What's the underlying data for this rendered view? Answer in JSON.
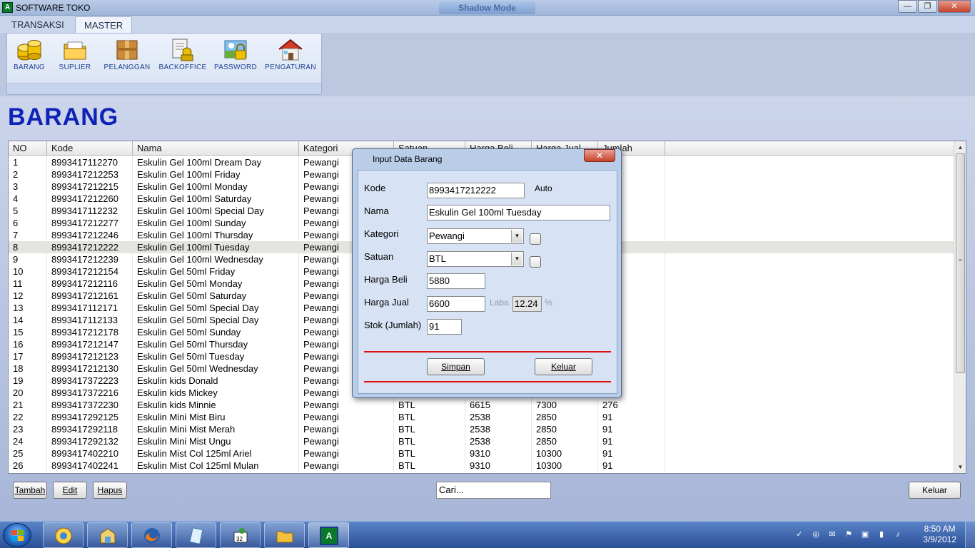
{
  "window": {
    "title": "SOFTWARE TOKO",
    "app_icon_letter": "A",
    "banner": "Shadow Mode",
    "min_glyph": "—",
    "max_glyph": "❐",
    "close_glyph": "✕"
  },
  "ribbon": {
    "tabs": [
      {
        "label": "TRANSAKSI"
      },
      {
        "label": "MASTER"
      }
    ],
    "active_tab": "MASTER",
    "items": [
      {
        "label": "BARANG",
        "icon": "coins-icon"
      },
      {
        "label": "SUPLIER",
        "icon": "folder-icon"
      },
      {
        "label": "PELANGGAN",
        "icon": "box-icon"
      },
      {
        "label": "BACKOFFICE",
        "icon": "office-icon"
      },
      {
        "label": "PASSWORD",
        "icon": "lock-icon"
      },
      {
        "label": "PENGATURAN",
        "icon": "house-icon"
      }
    ]
  },
  "page": {
    "title": "BARANG"
  },
  "table": {
    "headers": [
      "NO",
      "Kode",
      "Nama",
      "Kategori",
      "Satuan",
      "Harga Beli",
      "Harga Jual",
      "Jumlah"
    ],
    "selected_row": 8,
    "rows": [
      [
        "1",
        "8993417112270",
        "Eskulin Gel 100ml Dream Day",
        "Pewangi",
        "",
        "",
        "",
        ""
      ],
      [
        "2",
        "8993417212253",
        "Eskulin Gel 100ml Friday",
        "Pewangi",
        "",
        "",
        "",
        ""
      ],
      [
        "3",
        "8993417212215",
        "Eskulin Gel 100ml Monday",
        "Pewangi",
        "",
        "",
        "",
        ""
      ],
      [
        "4",
        "8993417212260",
        "Eskulin Gel 100ml Saturday",
        "Pewangi",
        "",
        "",
        "",
        ""
      ],
      [
        "5",
        "8993417112232",
        "Eskulin Gel 100ml Special Day",
        "Pewangi",
        "",
        "",
        "",
        ""
      ],
      [
        "6",
        "8993417212277",
        "Eskulin Gel 100ml Sunday",
        "Pewangi",
        "",
        "",
        "",
        ""
      ],
      [
        "7",
        "8993417212246",
        "Eskulin Gel 100ml Thursday",
        "Pewangi",
        "",
        "",
        "",
        ""
      ],
      [
        "8",
        "8993417212222",
        "Eskulin Gel 100ml Tuesday",
        "Pewangi",
        "",
        "",
        "",
        ""
      ],
      [
        "9",
        "8993417212239",
        "Eskulin Gel 100ml Wednesday",
        "Pewangi",
        "",
        "",
        "",
        ""
      ],
      [
        "10",
        "8993417212154",
        "Eskulin Gel 50ml Friday",
        "Pewangi",
        "",
        "",
        "",
        ""
      ],
      [
        "11",
        "8993417212116",
        "Eskulin Gel 50ml Monday",
        "Pewangi",
        "",
        "",
        "",
        ""
      ],
      [
        "12",
        "8993417212161",
        "Eskulin Gel 50ml Saturday",
        "Pewangi",
        "",
        "",
        "",
        ""
      ],
      [
        "13",
        "8993417112171",
        "Eskulin Gel 50ml Special Day",
        "Pewangi",
        "",
        "",
        "",
        ""
      ],
      [
        "14",
        "8993417112133",
        "Eskulin Gel 50ml Special Day",
        "Pewangi",
        "",
        "",
        "",
        ""
      ],
      [
        "15",
        "8993417212178",
        "Eskulin Gel 50ml Sunday",
        "Pewangi",
        "",
        "",
        "",
        ""
      ],
      [
        "16",
        "8993417212147",
        "Eskulin Gel 50ml Thursday",
        "Pewangi",
        "",
        "",
        "",
        ""
      ],
      [
        "17",
        "8993417212123",
        "Eskulin Gel 50ml Tuesday",
        "Pewangi",
        "",
        "",
        "",
        ""
      ],
      [
        "18",
        "8993417212130",
        "Eskulin Gel 50ml Wednesday",
        "Pewangi",
        "",
        "",
        "",
        ""
      ],
      [
        "19",
        "8993417372223",
        "Eskulin kids  Donald",
        "Pewangi",
        "",
        "",
        "",
        ""
      ],
      [
        "20",
        "8993417372216",
        "Eskulin kids Mickey",
        "Pewangi",
        "",
        "",
        "",
        ""
      ],
      [
        "21",
        "8993417372230",
        "Eskulin kids Minnie",
        "Pewangi",
        "BTL",
        "6615",
        "7300",
        "276"
      ],
      [
        "22",
        "8993417292125",
        "Eskulin Mini Mist Biru",
        "Pewangi",
        "BTL",
        "2538",
        "2850",
        "91"
      ],
      [
        "23",
        "8993417292118",
        "Eskulin Mini Mist Merah",
        "Pewangi",
        "BTL",
        "2538",
        "2850",
        "91"
      ],
      [
        "24",
        "8993417292132",
        "Eskulin Mini Mist Ungu",
        "Pewangi",
        "BTL",
        "2538",
        "2850",
        "91"
      ],
      [
        "25",
        "8993417402210",
        "Eskulin Mist Col 125ml Ariel",
        "Pewangi",
        "BTL",
        "9310",
        "10300",
        "91"
      ],
      [
        "26",
        "8993417402241",
        "Eskulin Mist Col 125ml Mulan",
        "Pewangi",
        "BTL",
        "9310",
        "10300",
        "91"
      ]
    ]
  },
  "buttons": {
    "tambah": "Tambah",
    "edit": "Edit",
    "hapus": "Hapus",
    "keluar": "Keluar"
  },
  "search": {
    "value": "Cari..."
  },
  "dialog": {
    "title": "Input Data Barang",
    "close_glyph": "✕",
    "fields": {
      "kode_label": "Kode",
      "kode_value": "8993417212222",
      "auto_label": "Auto",
      "nama_label": "Nama",
      "nama_value": "Eskulin Gel 100ml Tuesday",
      "kategori_label": "Kategori",
      "kategori_value": "Pewangi",
      "satuan_label": "Satuan",
      "satuan_value": "BTL",
      "harga_beli_label": "Harga Beli",
      "harga_beli_value": "5880",
      "harga_jual_label": "Harga Jual",
      "harga_jual_value": "6600",
      "laba_label": "Laba",
      "laba_value": "12.24",
      "percent": "%",
      "stok_label": "Stok (Jumlah)",
      "stok_value": "91"
    },
    "simpan": "Simpan",
    "keluar": "Keluar",
    "combo_arrow_glyph": "▼"
  },
  "scrollbar": {
    "up_glyph": "▲",
    "down_glyph": "▼",
    "grip": "≡"
  },
  "taskbar": {
    "apps": [
      "windows-explorer-icon",
      "store-app-icon",
      "firefox-icon",
      "notepad-icon",
      "game-icon",
      "folder-icon",
      "software-toko-icon"
    ],
    "active_app_letter": "A",
    "tray_icons": [
      "security-icon",
      "network-icon",
      "mail-icon",
      "flag-icon",
      "device-icon",
      "battery-icon",
      "volume-icon"
    ],
    "tray_glyphs": [
      "✓",
      "◎",
      "✉",
      "⚑",
      "▣",
      "▮",
      "♪"
    ],
    "time": "8:50 AM",
    "date": "3/9/2012"
  }
}
